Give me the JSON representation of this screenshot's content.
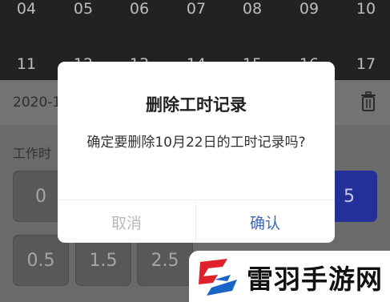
{
  "calendar": {
    "row1": [
      "04",
      "05",
      "06",
      "07",
      "08",
      "09",
      "10"
    ],
    "row2": [
      "11",
      "12",
      "13",
      "14",
      "15",
      "16",
      "17"
    ]
  },
  "date_bar": {
    "text": "2020-1"
  },
  "section_label": "工作时",
  "tiles_row1": [
    "0",
    "5"
  ],
  "tiles_row2": [
    "0.5",
    "1.5",
    "2.5"
  ],
  "dialog": {
    "title": "删除工时记录",
    "message": "确定要删除10月22日的工时记录吗?",
    "cancel_label": "取消",
    "confirm_label": "确认"
  },
  "watermark": {
    "text": "雷羽手游网"
  },
  "colors": {
    "accent": "#3e67b7",
    "selected_tile": "#23309a",
    "logo_red": "#e0202a",
    "logo_blue": "#1a64c8"
  }
}
